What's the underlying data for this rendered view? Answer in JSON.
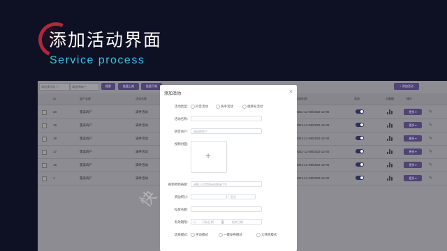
{
  "slide": {
    "title": "添加活动界面",
    "subtitle": "Service process",
    "accent_color": "#33c7e8",
    "watermark": "快"
  },
  "toolbar": {
    "search_placeholder": "请选择活动 ▽",
    "merchant_placeholder": "请选择商户",
    "buttons": [
      "搜索",
      "批量上架",
      "批量下架"
    ],
    "add_button": "+ 添加活动"
  },
  "table": {
    "headers": [
      "ID",
      "商户名称",
      "活动名称",
      "活动时间",
      "状态",
      "大数据",
      "操作",
      ""
    ],
    "rows": [
      {
        "id": "20",
        "merchant": "量美商户",
        "activity": "满件活动",
        "time": "2021-12-08/2022-12-00"
      },
      {
        "id": "19",
        "merchant": "量美商户",
        "activity": "满件活动",
        "time": "2021-12-08/2022-12-00"
      },
      {
        "id": "18",
        "merchant": "量美商户",
        "activity": "满件活动",
        "time": "2021-12-08/2022-12-00"
      },
      {
        "id": "17",
        "merchant": "量美商户",
        "activity": "满件活动",
        "time": "2021-12-08/2022-12-00"
      },
      {
        "id": "16",
        "merchant": "量美商户",
        "activity": "满件活动",
        "time": "2021-12-08/2022-12-00"
      },
      {
        "id": "1",
        "merchant": "量美商户",
        "activity": "满件活动",
        "time": "2021-12-08/2022-12-00"
      }
    ],
    "action_label": "更多 ▾"
  },
  "modal": {
    "title": "添加活动",
    "close": "×",
    "fields": {
      "type_label": "活动类型:",
      "type_options": [
        "抖音活动",
        "快手活动",
        "视频号活动"
      ],
      "name_label": "活动名称:",
      "merchant_label": "绑定商户:",
      "merchant_placeholder": "请选择商户",
      "cover_label": "视频封面:",
      "link_label": "视频原始链接:",
      "link_placeholder": "请输入抖音链接或链接口令",
      "reward_label": "奖励积分:",
      "reward_unit": "积分",
      "budget_label": "投放名额:",
      "period_label": "有效期限:",
      "period_start": "开始日期",
      "period_sep": "至",
      "period_end": "结束日期",
      "mode_label": "选择模式:",
      "mode_options": [
        "手动模式",
        "一键发布模式",
        "大转盘模式"
      ]
    }
  }
}
